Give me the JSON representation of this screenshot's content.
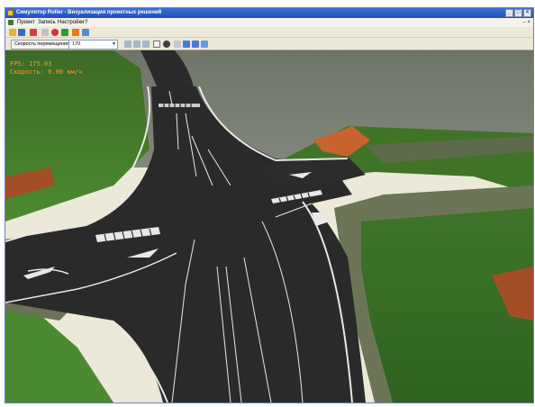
{
  "window": {
    "title": "Симулятор Roller - Визуализация проектных решений"
  },
  "menu": {
    "items": [
      "Проект",
      "Запись",
      "Настройки",
      "?"
    ]
  },
  "toolbar": {
    "speed_label": "Скорость перемещения",
    "speed_value": "170"
  },
  "hud": {
    "fps": "FPS: 175.03",
    "speed": "Скорость: 0.00 км/ч"
  },
  "colors": {
    "title_bar": "#245edb",
    "asphalt": "#2a2a2a",
    "grass": "#3f7a2a",
    "soil": "#b5582a",
    "hud": "#ff9a2a"
  }
}
